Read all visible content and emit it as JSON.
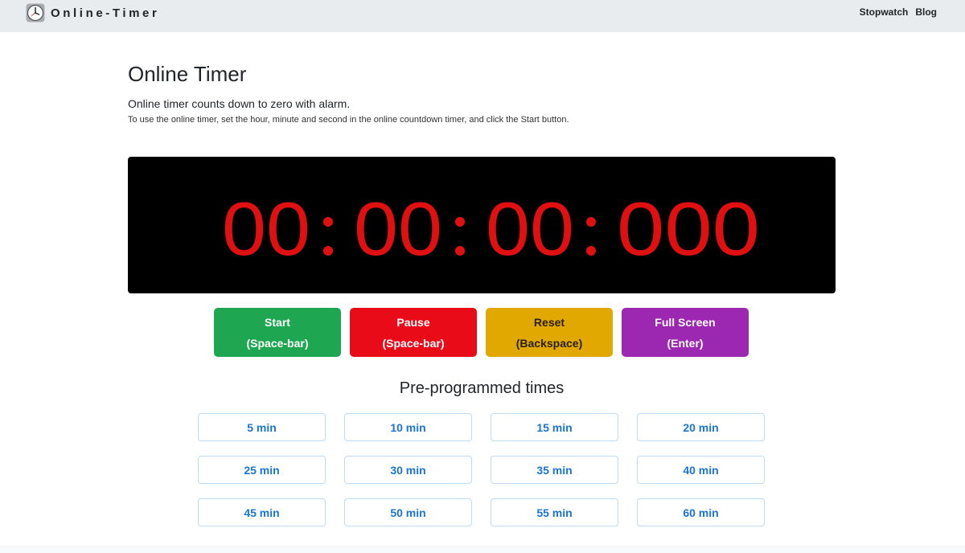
{
  "nav": {
    "brand": "Online-Timer",
    "links": [
      {
        "label": "Stopwatch"
      },
      {
        "label": "Blog"
      }
    ]
  },
  "page": {
    "title": "Online Timer",
    "lead": "Online timer counts down to zero with alarm.",
    "instructions": "To use the online timer, set the hour, minute and second in the online countdown timer, and click the Start button."
  },
  "timer": {
    "hours": "00",
    "minutes": "00",
    "seconds": "00",
    "milliseconds": "000",
    "digit_color": "#e01010",
    "background_color": "#000000"
  },
  "controls": {
    "start": {
      "label": "Start",
      "key": "(Space-bar)",
      "color": "#1fa651"
    },
    "pause": {
      "label": "Pause",
      "key": "(Space-bar)",
      "color": "#ea0b19"
    },
    "reset": {
      "label": "Reset",
      "key": "(Backspace)",
      "color": "#e0a800"
    },
    "fullscreen": {
      "label": "Full Screen",
      "key": "(Enter)",
      "color": "#9c27b0"
    }
  },
  "presets": {
    "title": "Pre-programmed times",
    "items": [
      "5 min",
      "10 min",
      "15 min",
      "20 min",
      "25 min",
      "30 min",
      "35 min",
      "40 min",
      "45 min",
      "50 min",
      "55 min",
      "60 min"
    ]
  }
}
